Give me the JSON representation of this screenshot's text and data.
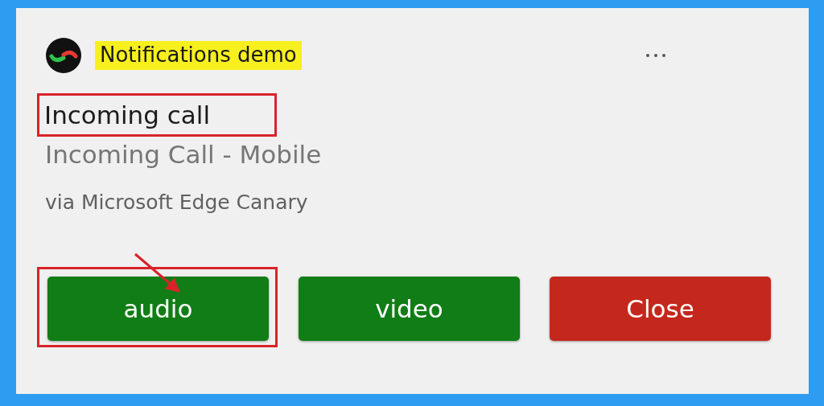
{
  "header": {
    "app_name": "Notifications demo",
    "highlighted": true
  },
  "notification": {
    "title": "Incoming call",
    "title_boxed": true,
    "body": "Incoming Call - Mobile",
    "attribution": "via Microsoft Edge Canary"
  },
  "buttons": [
    {
      "label": "audio",
      "color": "#117d16",
      "boxed": true
    },
    {
      "label": "video",
      "color": "#117d16",
      "boxed": false
    },
    {
      "label": "Close",
      "color": "#c4281c",
      "boxed": false
    }
  ]
}
